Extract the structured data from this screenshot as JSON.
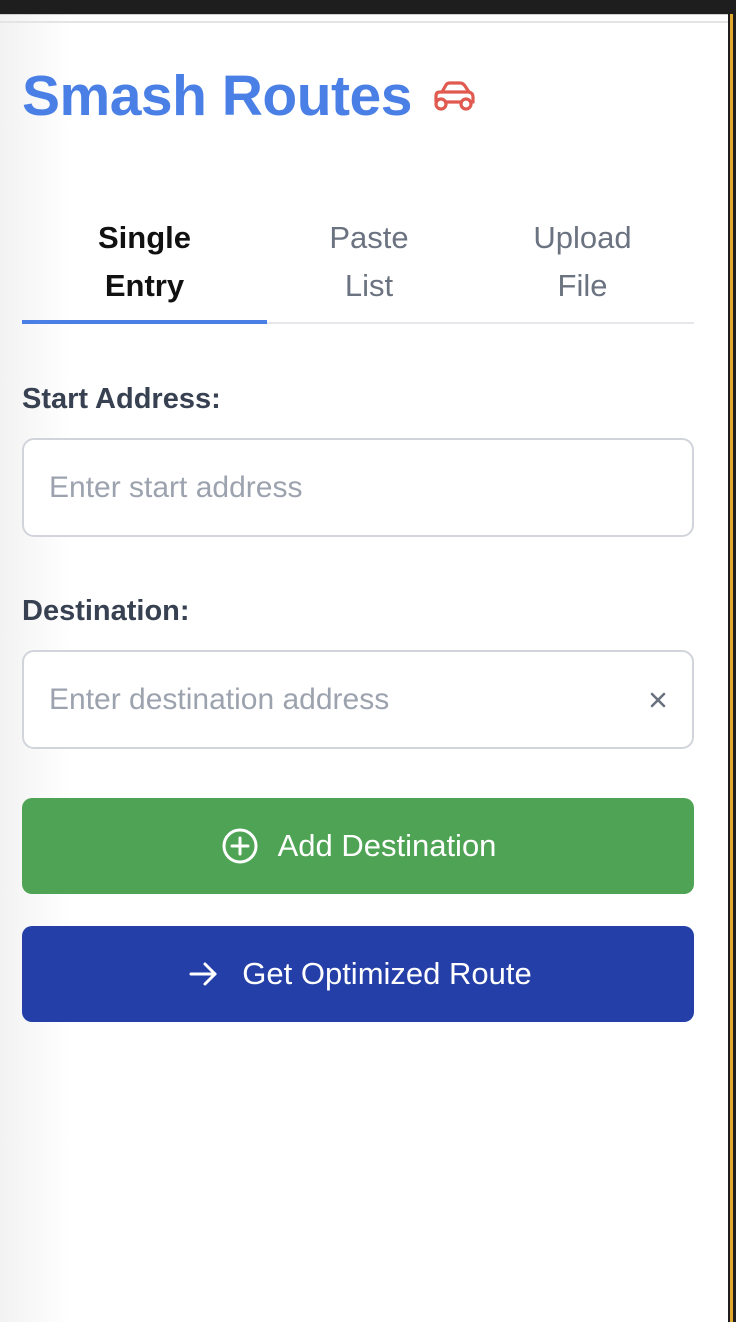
{
  "app": {
    "title": "Smash Routes",
    "brand_color": "#4a7fe6",
    "car_icon": "car-icon",
    "car_icon_color": "#e05a4f"
  },
  "tabs": [
    {
      "label": "Single Entry",
      "active": true
    },
    {
      "label": "Paste List",
      "active": false
    },
    {
      "label": "Upload File",
      "active": false
    }
  ],
  "form": {
    "start": {
      "label": "Start Address:",
      "placeholder": "Enter start address",
      "value": ""
    },
    "destination": {
      "label": "Destination:",
      "placeholder": "Enter destination address",
      "value": "",
      "clear_icon": "close-icon"
    }
  },
  "buttons": {
    "add": {
      "label": "Add Destination",
      "icon": "plus-circle-icon",
      "color": "#4ea454"
    },
    "route": {
      "label": "Get Optimized Route",
      "icon": "arrow-right-icon",
      "color": "#253fa9"
    }
  }
}
